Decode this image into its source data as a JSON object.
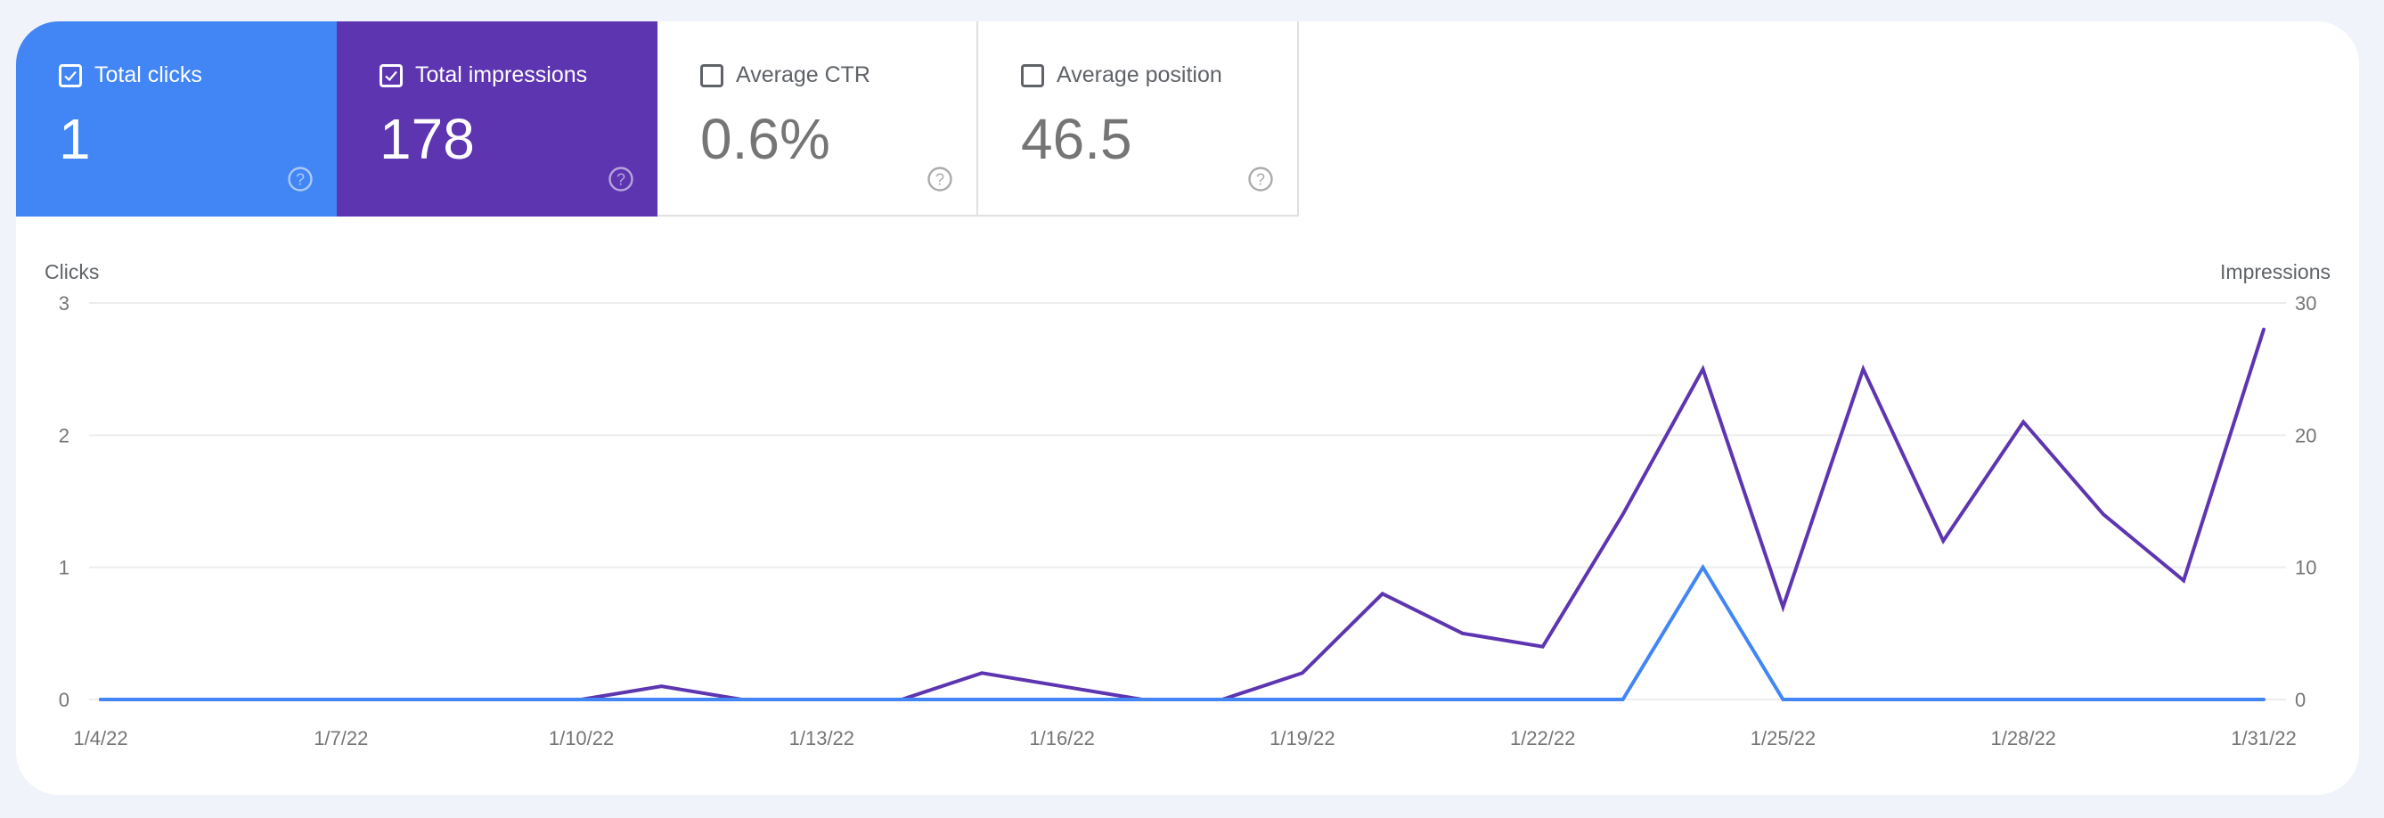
{
  "metrics": [
    {
      "label": "Total clicks",
      "value": "1",
      "checked": true,
      "color": "#4285f4",
      "icon": "help-circle-icon"
    },
    {
      "label": "Total impressions",
      "value": "178",
      "checked": true,
      "color": "#5e35b1",
      "icon": "help-circle-icon"
    },
    {
      "label": "Average CTR",
      "value": "0.6%",
      "checked": false,
      "icon": "help-circle-icon"
    },
    {
      "label": "Average position",
      "value": "46.5",
      "checked": false,
      "icon": "help-circle-icon"
    }
  ],
  "chart_data": {
    "type": "line",
    "title": "",
    "x": [
      "1/4/22",
      "1/5/22",
      "1/6/22",
      "1/7/22",
      "1/8/22",
      "1/9/22",
      "1/10/22",
      "1/11/22",
      "1/12/22",
      "1/13/22",
      "1/14/22",
      "1/15/22",
      "1/16/22",
      "1/17/22",
      "1/18/22",
      "1/19/22",
      "1/20/22",
      "1/21/22",
      "1/22/22",
      "1/23/22",
      "1/24/22",
      "1/25/22",
      "1/26/22",
      "1/27/22",
      "1/28/22",
      "1/29/22",
      "1/30/22",
      "1/31/22"
    ],
    "x_tick_labels": [
      "1/4/22",
      "1/7/22",
      "1/10/22",
      "1/13/22",
      "1/16/22",
      "1/19/22",
      "1/22/22",
      "1/25/22",
      "1/28/22",
      "1/31/22"
    ],
    "series": [
      {
        "name": "Impressions",
        "axis": "right",
        "color": "#5e35b1",
        "values": [
          0,
          0,
          0,
          0,
          0,
          0,
          0,
          1,
          0,
          0,
          0,
          2,
          1,
          0,
          0,
          2,
          8,
          5,
          4,
          14,
          25,
          7,
          25,
          12,
          21,
          14,
          9,
          28
        ]
      },
      {
        "name": "Clicks",
        "axis": "left",
        "color": "#4285f4",
        "values": [
          0,
          0,
          0,
          0,
          0,
          0,
          0,
          0,
          0,
          0,
          0,
          0,
          0,
          0,
          0,
          0,
          0,
          0,
          0,
          0,
          1,
          0,
          0,
          0,
          0,
          0,
          0,
          0
        ]
      }
    ],
    "ylabel_left": "Clicks",
    "ylabel_right": "Impressions",
    "ylim_left": [
      0,
      3
    ],
    "ylim_right": [
      0,
      30
    ],
    "yticks_left": [
      "0",
      "1",
      "2",
      "3"
    ],
    "yticks_right": [
      "0",
      "10",
      "20",
      "30"
    ],
    "grid": true,
    "legend": "none"
  }
}
